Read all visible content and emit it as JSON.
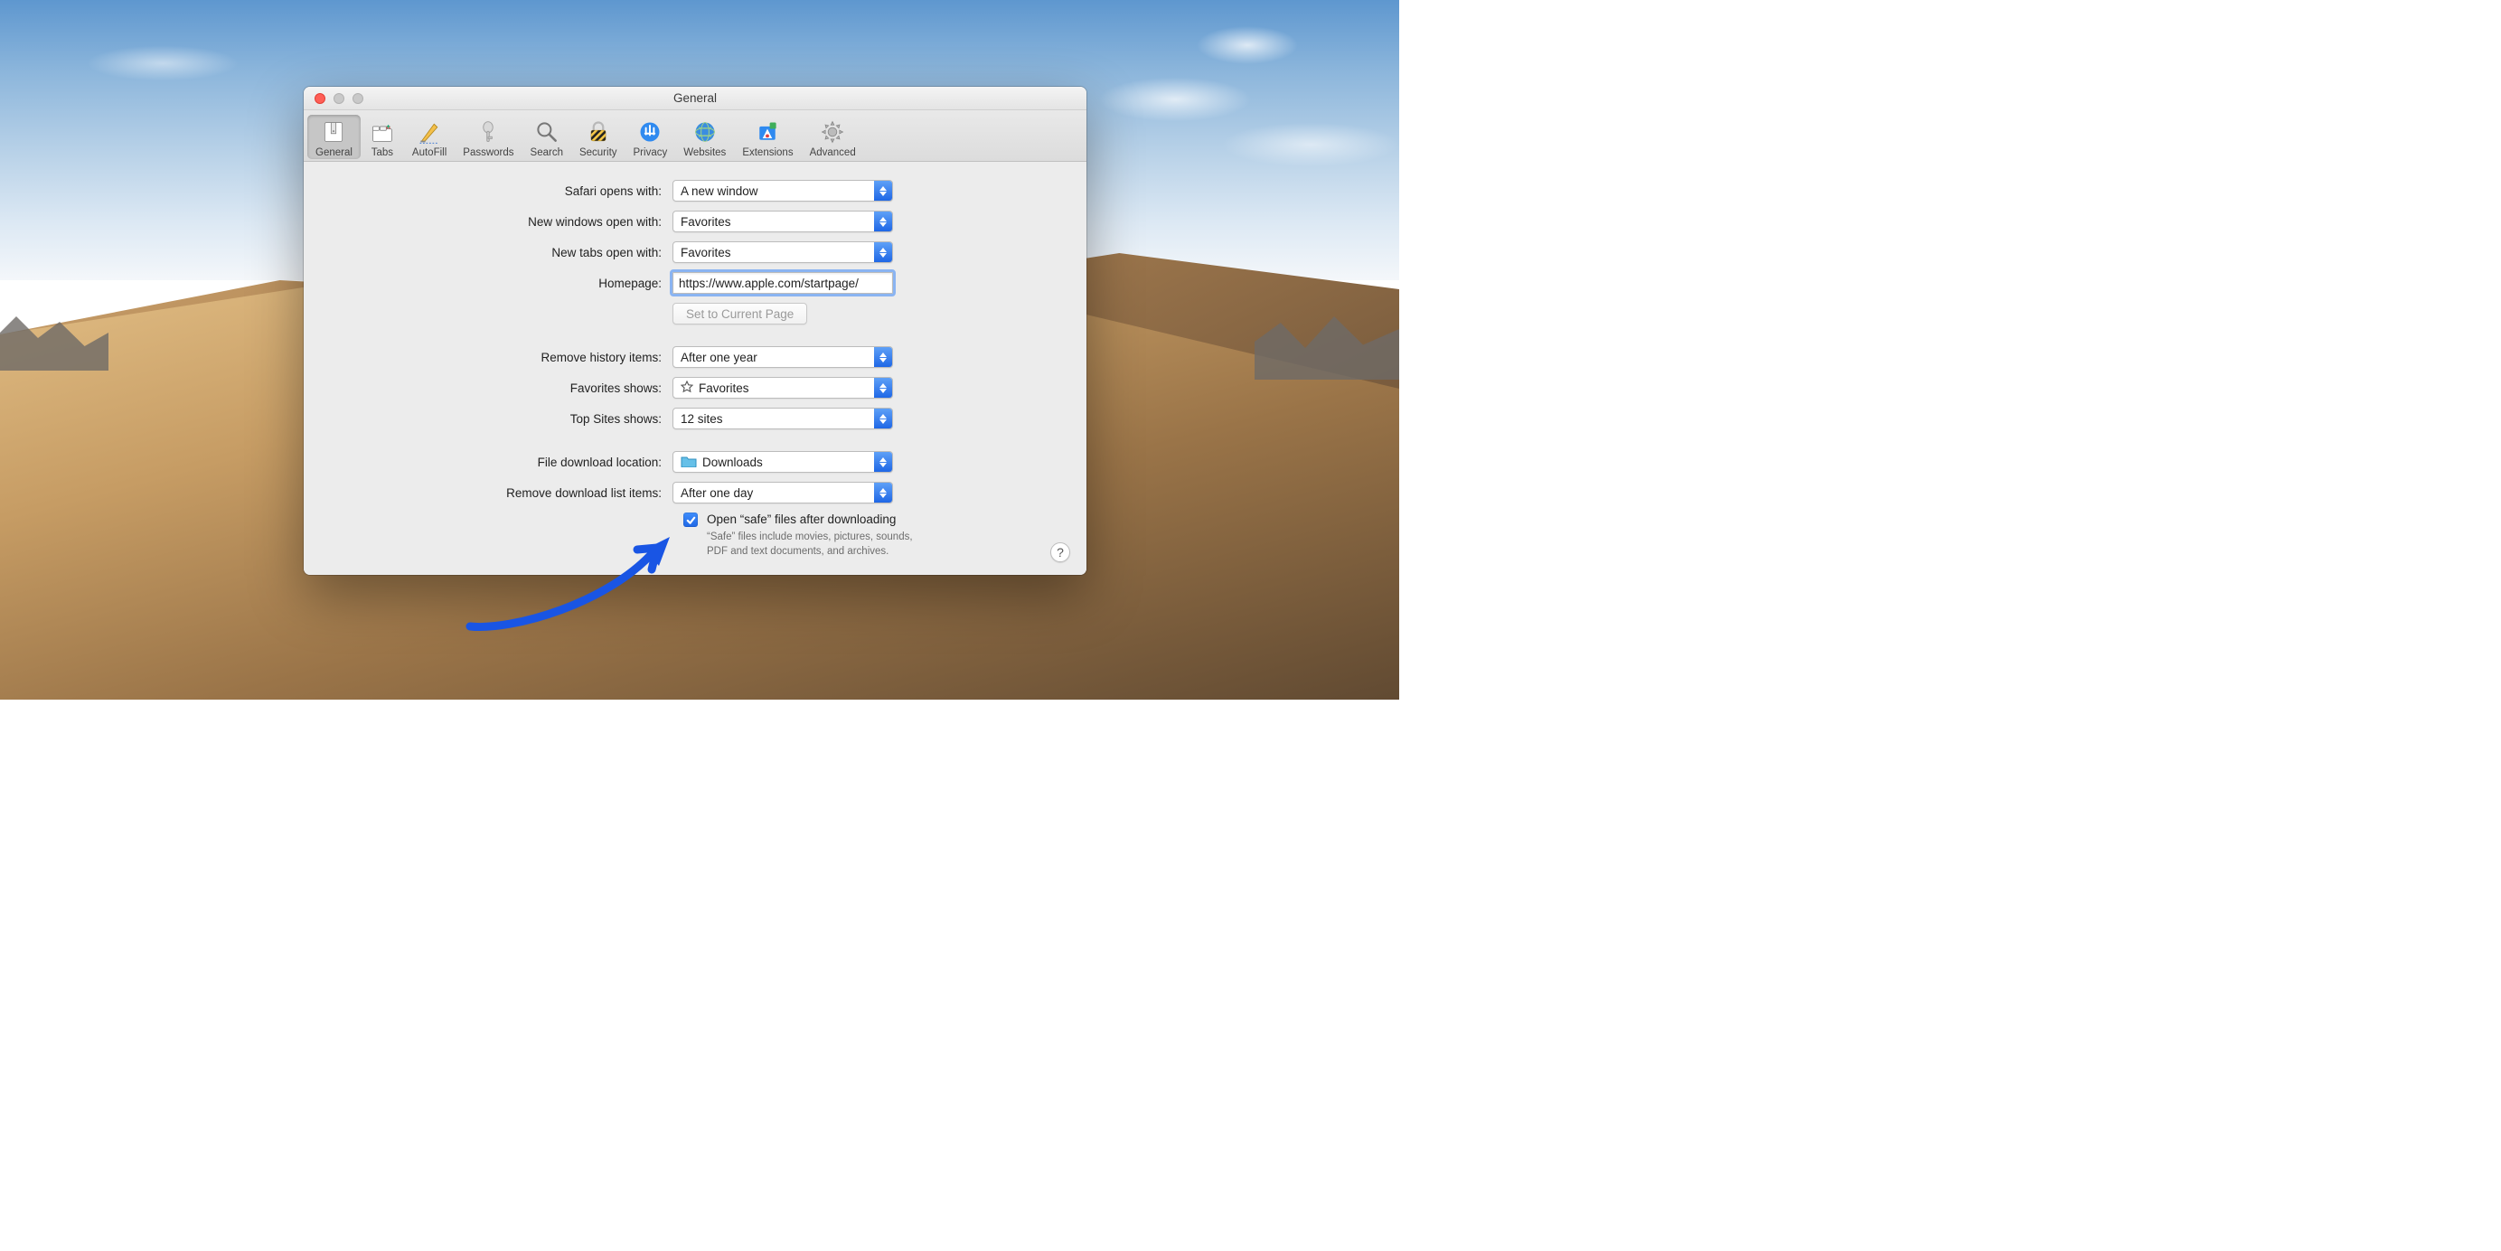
{
  "window": {
    "title": "General"
  },
  "toolbar": {
    "general": "General",
    "tabs": "Tabs",
    "autofill": "AutoFill",
    "passwords": "Passwords",
    "search": "Search",
    "security": "Security",
    "privacy": "Privacy",
    "websites": "Websites",
    "extensions": "Extensions",
    "advanced": "Advanced"
  },
  "labels": {
    "safari_opens": "Safari opens with:",
    "new_windows": "New windows open with:",
    "new_tabs": "New tabs open with:",
    "homepage": "Homepage:",
    "set_current": "Set to Current Page",
    "remove_history": "Remove history items:",
    "favorites_shows": "Favorites shows:",
    "top_sites_shows": "Top Sites shows:",
    "download_location": "File download location:",
    "remove_downloads": "Remove download list items:",
    "open_safe": "Open “safe” files after downloading",
    "safe_desc": "“Safe” files include movies, pictures, sounds, PDF and text documents, and archives."
  },
  "values": {
    "safari_opens": "A new window",
    "new_windows": "Favorites",
    "new_tabs": "Favorites",
    "homepage": "https://www.apple.com/startpage/",
    "remove_history": "After one year",
    "favorites_shows": "Favorites",
    "top_sites_shows": "12 sites",
    "download_location": "Downloads",
    "remove_downloads": "After one day",
    "open_safe_checked": true
  },
  "help": "?"
}
